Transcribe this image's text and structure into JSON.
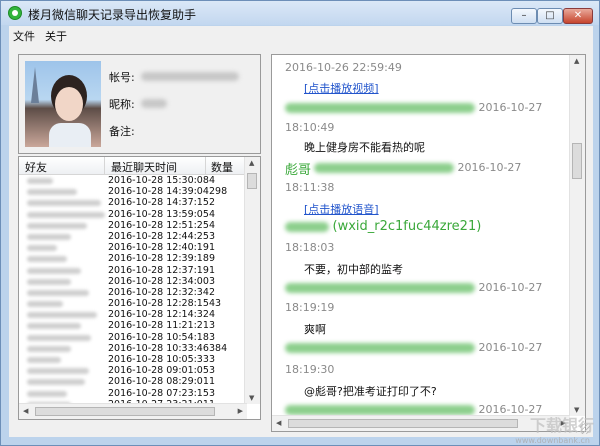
{
  "window": {
    "title": "楼月微信聊天记录导出恢复助手",
    "min_glyph": "–",
    "max_glyph": "□",
    "close_glyph": "✕"
  },
  "menu": {
    "file": "文件",
    "about": "关于"
  },
  "profile": {
    "account_label": "帐号:",
    "nickname_label": "昵称:",
    "note_label": "备注:"
  },
  "friends_table": {
    "headers": [
      "好友",
      "最近聊天时间",
      "数量"
    ],
    "rows": [
      {
        "date": "2016-10-28 15:30:08",
        "count": "4"
      },
      {
        "date": "2016-10-28 14:39:04",
        "count": "298"
      },
      {
        "date": "2016-10-28 14:37:15",
        "count": "2"
      },
      {
        "date": "2016-10-28 13:59:05",
        "count": "4"
      },
      {
        "date": "2016-10-28 12:51:25",
        "count": "4"
      },
      {
        "date": "2016-10-28 12:44:25",
        "count": "3"
      },
      {
        "date": "2016-10-28 12:40:19",
        "count": "1"
      },
      {
        "date": "2016-10-28 12:39:18",
        "count": "9"
      },
      {
        "date": "2016-10-28 12:37:19",
        "count": "1"
      },
      {
        "date": "2016-10-28 12:34:00",
        "count": "3"
      },
      {
        "date": "2016-10-28 12:32:34",
        "count": "2"
      },
      {
        "date": "2016-10-28 12:28:15",
        "count": "43"
      },
      {
        "date": "2016-10-28 12:14:32",
        "count": "4"
      },
      {
        "date": "2016-10-28 11:21:21",
        "count": "3"
      },
      {
        "date": "2016-10-28 10:54:18",
        "count": "3"
      },
      {
        "date": "2016-10-28 10:33:46",
        "count": "384"
      },
      {
        "date": "2016-10-28 10:05:33",
        "count": "3"
      },
      {
        "date": "2016-10-28 09:01:05",
        "count": "3"
      },
      {
        "date": "2016-10-28 08:29:01",
        "count": "1"
      },
      {
        "date": "2016-10-28 07:23:15",
        "count": "3"
      },
      {
        "date": "2016-10-27 23:21:01",
        "count": "1"
      }
    ]
  },
  "chat": {
    "messages": [
      {
        "kind": "timestamp",
        "text": "2016-10-26 22:59:49"
      },
      {
        "kind": "link",
        "text": "[点击播放视频]"
      },
      {
        "kind": "sender",
        "text": "2016-10-27"
      },
      {
        "kind": "time",
        "text": "18:10:49"
      },
      {
        "kind": "text",
        "text": "晚上健身房不能看热的呢"
      },
      {
        "kind": "sender",
        "text": "彪哥"
      },
      {
        "kind": "sender_date",
        "text": "2016-10-27"
      },
      {
        "kind": "time",
        "text": "18:11:38"
      },
      {
        "kind": "link",
        "text": "[点击播放语音]"
      },
      {
        "kind": "sender",
        "text": "(wxid_r2c1fuc44zre21)"
      },
      {
        "kind": "time",
        "text": "18:18:03"
      },
      {
        "kind": "text",
        "text": "不要，初中部的监考"
      },
      {
        "kind": "sender_date",
        "text": "2016-10-27"
      },
      {
        "kind": "time",
        "text": "18:19:19"
      },
      {
        "kind": "text",
        "text": "爽啊"
      },
      {
        "kind": "sender_date",
        "text": "2016-10-27"
      },
      {
        "kind": "time",
        "text": "18:19:30"
      },
      {
        "kind": "text",
        "text": "@彪哥?把准考证打印了不?"
      },
      {
        "kind": "sender_date",
        "text": "2016-10-27"
      }
    ]
  },
  "watermark": {
    "main": "下载银行",
    "sub": "www.downbank.cn"
  },
  "colors": {
    "link": "#2255cc",
    "sender": "#3aa83a",
    "timestamp": "#8a8a8a",
    "app_icon": "#32b43c"
  }
}
